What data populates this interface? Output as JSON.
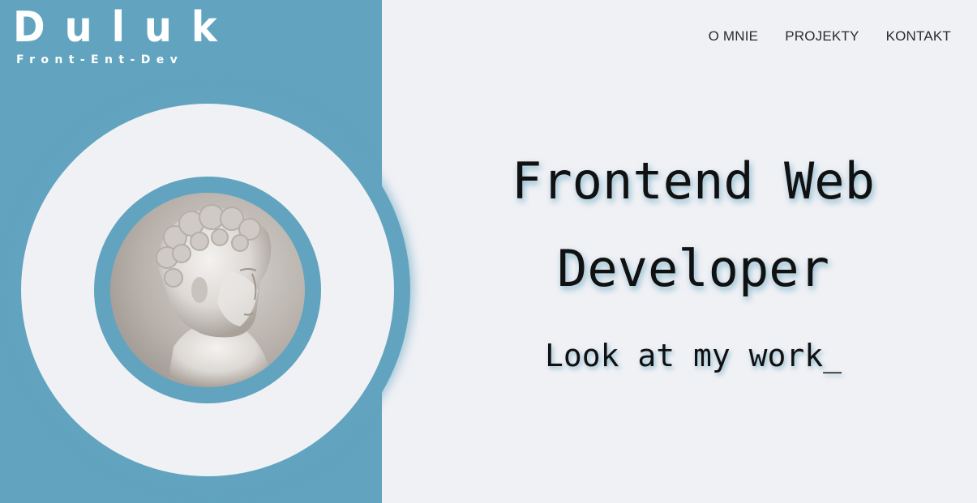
{
  "logo": {
    "title": "Duluk",
    "subtitle": "Front-Ent-Dev"
  },
  "nav": {
    "items": [
      {
        "label": "O MNIE"
      },
      {
        "label": "PROJEKTY"
      },
      {
        "label": "KONTAKT"
      }
    ]
  },
  "hero": {
    "title_line1": "Frontend Web",
    "title_line2": "Developer",
    "subtitle": "Look at my work_"
  },
  "portrait": {
    "icon": "statue-portrait"
  },
  "colors": {
    "accent": "#62a4bf",
    "background": "#f0f1f5",
    "text": "#111111"
  }
}
